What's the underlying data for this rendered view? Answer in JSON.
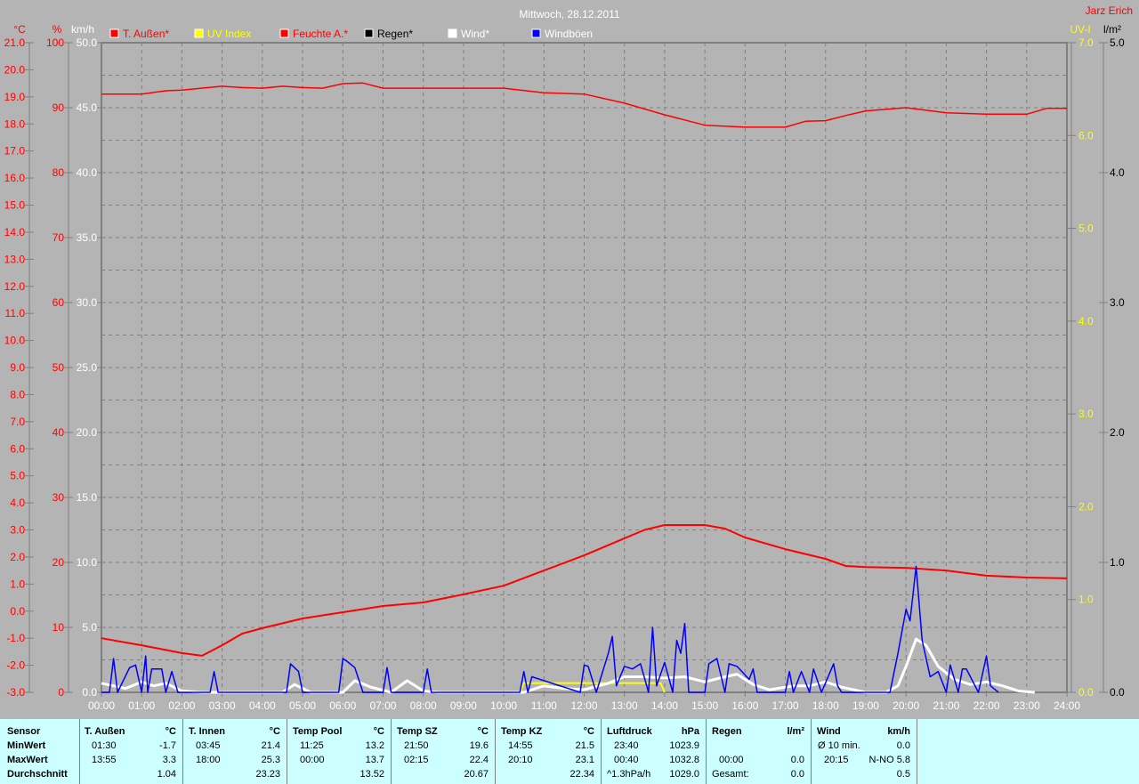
{
  "header": {
    "title": "Mittwoch, 28.12.2011",
    "user": "Jarz Erich"
  },
  "legend": [
    {
      "label": "T. Außen*",
      "color": "#ff0000",
      "text_color": "#ff0000"
    },
    {
      "label": "UV Index",
      "color": "#ffff00",
      "text_color": "#ffff00"
    },
    {
      "label": "Feuchte A.*",
      "color": "#ff0000",
      "text_color": "#ff0000"
    },
    {
      "label": "Regen*",
      "color": "#000000",
      "text_color": "#000000"
    },
    {
      "label": "Wind*",
      "color": "#ffffff",
      "text_color": "#ffffff"
    },
    {
      "label": "Windböen",
      "color": "#0000ff",
      "text_color": "#ffffff"
    }
  ],
  "chart_data": {
    "type": "line",
    "title": "Mittwoch, 28.12.2011",
    "xlabel": "",
    "x_ticks": [
      "00:00",
      "01:00",
      "02:00",
      "03:00",
      "04:00",
      "05:00",
      "06:00",
      "07:00",
      "08:00",
      "09:00",
      "10:00",
      "11:00",
      "12:00",
      "13:00",
      "14:00",
      "15:00",
      "16:00",
      "17:00",
      "18:00",
      "19:00",
      "20:00",
      "21:00",
      "22:00",
      "23:00",
      "24:00"
    ],
    "xlim": [
      0,
      24
    ],
    "grid": true,
    "legend_position": "top",
    "axes": {
      "temp": {
        "unit": "°C",
        "range": [
          -3,
          21
        ],
        "ticks": [
          "21.0",
          "20.0",
          "19.0",
          "18.0",
          "17.0",
          "16.0",
          "15.0",
          "14.0",
          "13.0",
          "12.0",
          "11.0",
          "10.0",
          "9.0",
          "8.0",
          "7.0",
          "6.0",
          "5.0",
          "4.0",
          "3.0",
          "2.0",
          "1.0",
          "0.0",
          "-1.0",
          "-2.0",
          "-3.0"
        ]
      },
      "humidity": {
        "unit": "%",
        "range": [
          0,
          100
        ],
        "ticks": [
          "100",
          "90",
          "80",
          "70",
          "60",
          "50",
          "40",
          "30",
          "20",
          "10",
          "0"
        ]
      },
      "wind": {
        "unit": "km/h",
        "range": [
          0,
          50
        ],
        "ticks": [
          "50.0",
          "45.0",
          "40.0",
          "35.0",
          "30.0",
          "25.0",
          "20.0",
          "15.0",
          "10.0",
          "5.0",
          "0.0"
        ]
      },
      "uv": {
        "unit": "UV-I",
        "range": [
          0,
          7
        ],
        "ticks": [
          "7.0",
          "6.0",
          "5.0",
          "4.0",
          "3.0",
          "2.0",
          "1.0",
          "0.0"
        ]
      },
      "rain": {
        "unit": "l/m²",
        "range": [
          0,
          5
        ],
        "ticks": [
          "5.0",
          "4.0",
          "3.0",
          "2.0",
          "1.0",
          "0.0"
        ]
      }
    },
    "series": [
      {
        "name": "T. Außen*",
        "axis": "temp",
        "color": "#ff0000",
        "x": [
          0,
          1,
          2,
          2.5,
          3,
          3.5,
          4,
          5,
          6,
          7,
          8,
          9,
          10,
          11,
          12,
          13,
          13.5,
          14,
          15,
          15.5,
          16,
          17,
          18,
          18.5,
          19,
          20,
          21,
          22,
          23,
          24
        ],
        "y": [
          -1.0,
          -1.26,
          -1.55,
          -1.65,
          -1.26,
          -0.83,
          -0.63,
          -0.27,
          -0.04,
          0.19,
          0.32,
          0.62,
          0.94,
          1.5,
          2.06,
          2.69,
          3.0,
          3.18,
          3.18,
          3.05,
          2.72,
          2.29,
          1.93,
          1.67,
          1.63,
          1.6,
          1.5,
          1.31,
          1.24,
          1.21
        ]
      },
      {
        "name": "Feuchte A.*",
        "axis": "humidity",
        "color": "#ff0000",
        "x": [
          0,
          1,
          1.6,
          2,
          3,
          3.5,
          4,
          4.5,
          5,
          5.5,
          6,
          6.5,
          7,
          8,
          9,
          10,
          11,
          12,
          13,
          14,
          15,
          16,
          17,
          17.5,
          18,
          18.5,
          19,
          20,
          21,
          22,
          23,
          23.5,
          24
        ],
        "y": [
          92.1,
          92.1,
          92.6,
          92.7,
          93.3,
          93.1,
          93.0,
          93.3,
          93.1,
          93.0,
          93.7,
          93.8,
          93.0,
          93.0,
          93.0,
          93.0,
          92.3,
          92.1,
          90.7,
          88.9,
          87.3,
          87.0,
          87.0,
          87.9,
          88.0,
          88.8,
          89.5,
          90.0,
          89.2,
          89.0,
          89.0,
          89.9,
          89.9
        ]
      },
      {
        "name": "UV Index",
        "axis": "uv",
        "color": "#ffff00",
        "x": [
          10.4,
          10.5,
          13.9,
          14.0
        ],
        "y": [
          0,
          0.1,
          0.1,
          0
        ]
      },
      {
        "name": "Wind*",
        "axis": "wind",
        "color": "#ffffff",
        "x": [
          0,
          0.3,
          0.6,
          1.0,
          1.3,
          1.6,
          2.0,
          2.5,
          3.0,
          4.5,
          4.8,
          5.2,
          6.0,
          6.3,
          6.7,
          7.2,
          7.6,
          8.0,
          8.4,
          10.5,
          11.0,
          11.5,
          12.0,
          12.6,
          13.0,
          13.5,
          14.0,
          14.5,
          15.0,
          15.5,
          15.8,
          16.2,
          16.6,
          17.2,
          17.6,
          18.0,
          18.4,
          19.0,
          19.5,
          19.8,
          20.0,
          20.25,
          20.5,
          20.8,
          21.2,
          21.6,
          22.0,
          22.4,
          22.8,
          23.2
        ],
        "y": [
          0.7,
          0.5,
          0.3,
          0.8,
          0.5,
          0.7,
          0.1,
          0.0,
          0.0,
          0.0,
          0.6,
          0.0,
          0.0,
          0.9,
          0.4,
          0.0,
          0.9,
          0.1,
          0.0,
          0.0,
          0.5,
          0.3,
          0.2,
          0.7,
          1.2,
          1.2,
          1.1,
          1.2,
          0.8,
          1.2,
          1.4,
          0.6,
          0.2,
          0.5,
          0.5,
          0.8,
          0.4,
          0.0,
          0.0,
          0.5,
          2.0,
          4.1,
          3.6,
          2.0,
          1.0,
          0.6,
          0.8,
          0.5,
          0.1,
          0.0
        ]
      },
      {
        "name": "Windböen",
        "axis": "wind",
        "color": "#0000ff",
        "x": [
          0,
          0.2,
          0.3,
          0.4,
          0.7,
          0.85,
          1.0,
          1.1,
          1.15,
          1.25,
          1.5,
          1.6,
          1.75,
          1.9,
          2.7,
          2.8,
          2.9,
          4.6,
          4.7,
          4.9,
          5.0,
          5.9,
          6.0,
          6.1,
          6.3,
          6.5,
          7.0,
          7.1,
          7.2,
          8.0,
          8.1,
          8.2,
          10.4,
          10.5,
          10.6,
          10.7,
          11.9,
          12.0,
          12.1,
          12.3,
          12.6,
          12.7,
          12.8,
          13.0,
          13.2,
          13.4,
          13.6,
          13.7,
          13.8,
          14.0,
          14.2,
          14.3,
          14.4,
          14.5,
          14.6,
          15.0,
          15.1,
          15.3,
          15.5,
          15.6,
          15.8,
          16.1,
          16.2,
          16.3,
          17.0,
          17.1,
          17.2,
          17.4,
          17.6,
          17.7,
          17.9,
          18.2,
          18.3,
          18.4,
          19.6,
          19.8,
          20.0,
          20.1,
          20.25,
          20.4,
          20.6,
          20.8,
          21.0,
          21.1,
          21.3,
          21.4,
          21.5,
          21.8,
          22.0,
          22.1,
          22.3
        ],
        "y": [
          0,
          0,
          2.6,
          0,
          1.9,
          2.1,
          0,
          2.8,
          0,
          1.8,
          1.8,
          0,
          1.6,
          0,
          0,
          1.6,
          0,
          0,
          2.2,
          1.6,
          0,
          0,
          2.6,
          2.4,
          1.9,
          0,
          0,
          1.9,
          0,
          0,
          1.8,
          0,
          0,
          1.6,
          0,
          1.2,
          0,
          2.1,
          2.0,
          0,
          3.0,
          4.3,
          0.5,
          2.0,
          1.8,
          2.2,
          0,
          5.0,
          0.5,
          2.3,
          0,
          4.0,
          3.0,
          5.3,
          0,
          0,
          2.2,
          2.6,
          0,
          2.2,
          2.0,
          1.0,
          1.8,
          0,
          0,
          1.6,
          0,
          1.6,
          0,
          1.8,
          0,
          2.2,
          0.5,
          0,
          0,
          3.0,
          6.4,
          5.5,
          9.7,
          4.0,
          1.2,
          1.6,
          0,
          2.1,
          0,
          1.8,
          1.8,
          0,
          2.8,
          0.5,
          0
        ]
      }
    ]
  },
  "table": {
    "row_labels": [
      "Sensor",
      "MinWert",
      "MaxWert",
      "Durchschnitt"
    ],
    "columns": [
      {
        "name": "T. Außen",
        "unit": "°C",
        "min_time": "01:30",
        "min": "-1.7",
        "max_time": "13:55",
        "max": "3.3",
        "avg_label": "",
        "avg": "1.04"
      },
      {
        "name": "T. Innen",
        "unit": "°C",
        "min_time": "03:45",
        "min": "21.4",
        "max_time": "18:00",
        "max": "25.3",
        "avg_label": "",
        "avg": "23.23"
      },
      {
        "name": "Temp Pool",
        "unit": "°C",
        "min_time": "11:25",
        "min": "13.2",
        "max_time": "00:00",
        "max": "13.7",
        "avg_label": "",
        "avg": "13.52"
      },
      {
        "name": "Temp SZ",
        "unit": "°C",
        "min_time": "21:50",
        "min": "19.6",
        "max_time": "02:15",
        "max": "22.4",
        "avg_label": "",
        "avg": "20.67"
      },
      {
        "name": "Temp KZ",
        "unit": "°C",
        "min_time": "14:55",
        "min": "21.5",
        "max_time": "20:10",
        "max": "23.1",
        "avg_label": "",
        "avg": "22.34"
      },
      {
        "name": "Luftdruck",
        "unit": "hPa",
        "min_time": "23:40",
        "min": "1023.9",
        "max_time": "00:40",
        "max": "1032.8",
        "avg_label": "^1.3hPa/h",
        "avg": "1029.0"
      },
      {
        "name": "Regen",
        "unit": "l/m²",
        "min_time": "",
        "min": "",
        "max_time": "00:00",
        "max": "0.0",
        "avg_label": "Gesamt:",
        "avg": "0.0"
      },
      {
        "name": "Wind",
        "unit": "km/h",
        "min_time": "Ø 10 min.",
        "min": "0.0",
        "max_time": "20:15",
        "max": "N-NO 5.8",
        "avg_label": "",
        "avg": "0.5"
      }
    ]
  }
}
